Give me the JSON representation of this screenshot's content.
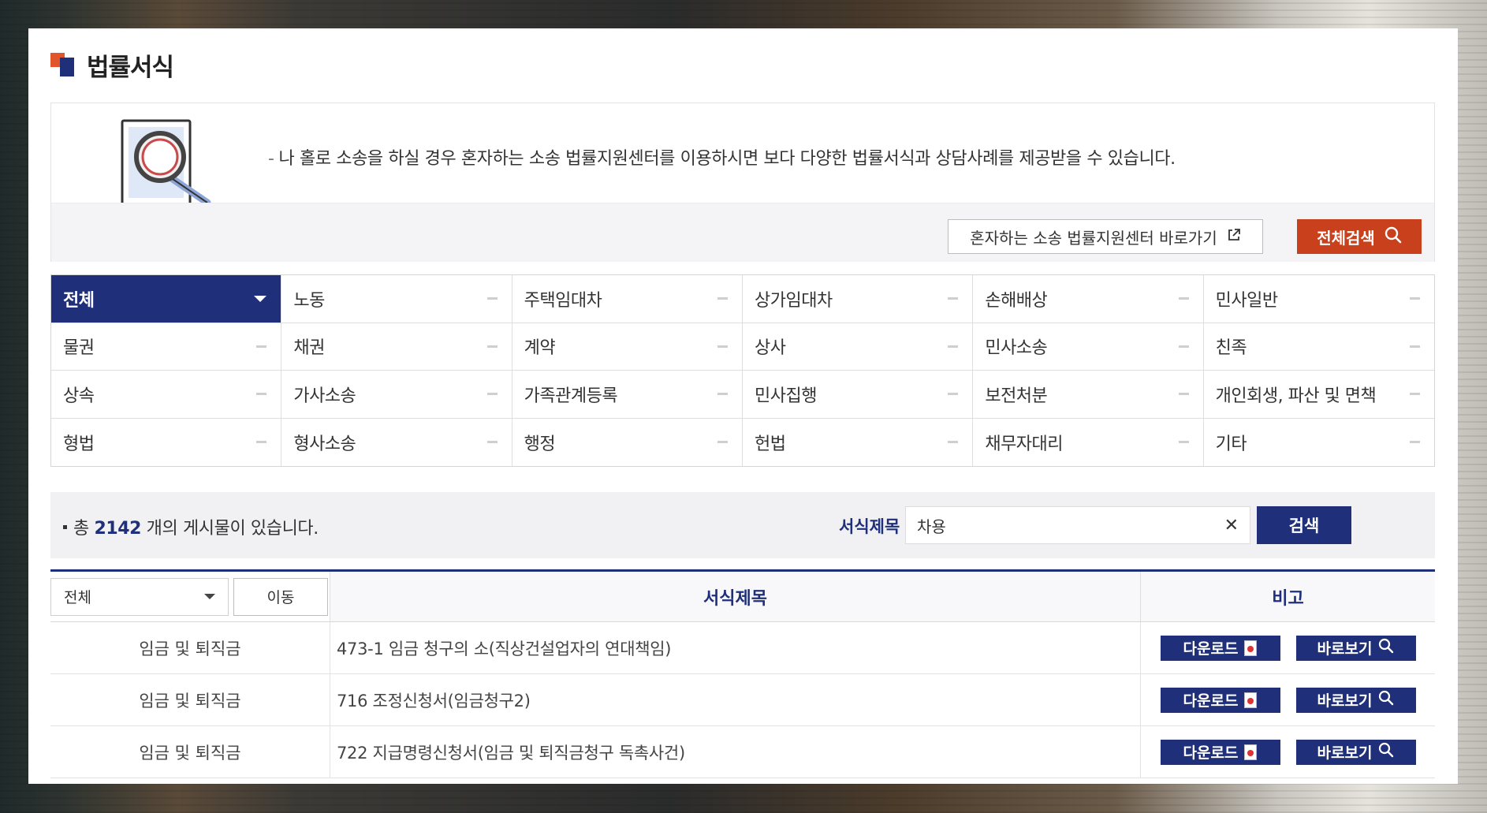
{
  "page": {
    "title": "법률서식",
    "intro_text": "나 홀로 소송을 하실 경우 혼자하는 소송 법률지원센터를 이용하시면 보다 다양한 법률서식과 상담사례를 제공받을 수 있습니다.",
    "intro_dash": "-",
    "link_button": "혼자하는 소송 법률지원센터 바로가기",
    "search_all_button": "전체검색"
  },
  "categories": [
    {
      "label": "전체"
    },
    {
      "label": "노동"
    },
    {
      "label": "주택임대차"
    },
    {
      "label": "상가임대차"
    },
    {
      "label": "손해배상"
    },
    {
      "label": "민사일반"
    },
    {
      "label": "물권"
    },
    {
      "label": "채권"
    },
    {
      "label": "계약"
    },
    {
      "label": "상사"
    },
    {
      "label": "민사소송"
    },
    {
      "label": "친족"
    },
    {
      "label": "상속"
    },
    {
      "label": "가사소송"
    },
    {
      "label": "가족관계등록"
    },
    {
      "label": "민사집행"
    },
    {
      "label": "보전처분"
    },
    {
      "label": "개인회생, 파산 및 면책"
    },
    {
      "label": "형법"
    },
    {
      "label": "형사소송"
    },
    {
      "label": "행정"
    },
    {
      "label": "헌법"
    },
    {
      "label": "채무자대리"
    },
    {
      "label": "기타"
    }
  ],
  "search": {
    "total_prefix": "총",
    "total_count": "2142",
    "total_suffix": "개의 게시물이 있습니다.",
    "label": "서식제목",
    "value": "차용",
    "clear_symbol": "✕",
    "button": "검색"
  },
  "table": {
    "filter_select": "전체",
    "move_button": "이동",
    "col_title": "서식제목",
    "col_note": "비고",
    "download_label": "다운로드",
    "view_label": "바로보기",
    "rows": [
      {
        "category": "임금 및 퇴직금",
        "title": "473-1 임금 청구의 소(직상건설업자의 연대책임)"
      },
      {
        "category": "임금 및 퇴직금",
        "title": "716 조정신청서(임금청구2)"
      },
      {
        "category": "임금 및 퇴직금",
        "title": "722 지급명령신청서(임금 및 퇴직금청구 독촉사건)"
      }
    ]
  },
  "colors": {
    "navy": "#1f2f7a",
    "orange": "#c9411c",
    "logo_orange": "#e0562a"
  }
}
